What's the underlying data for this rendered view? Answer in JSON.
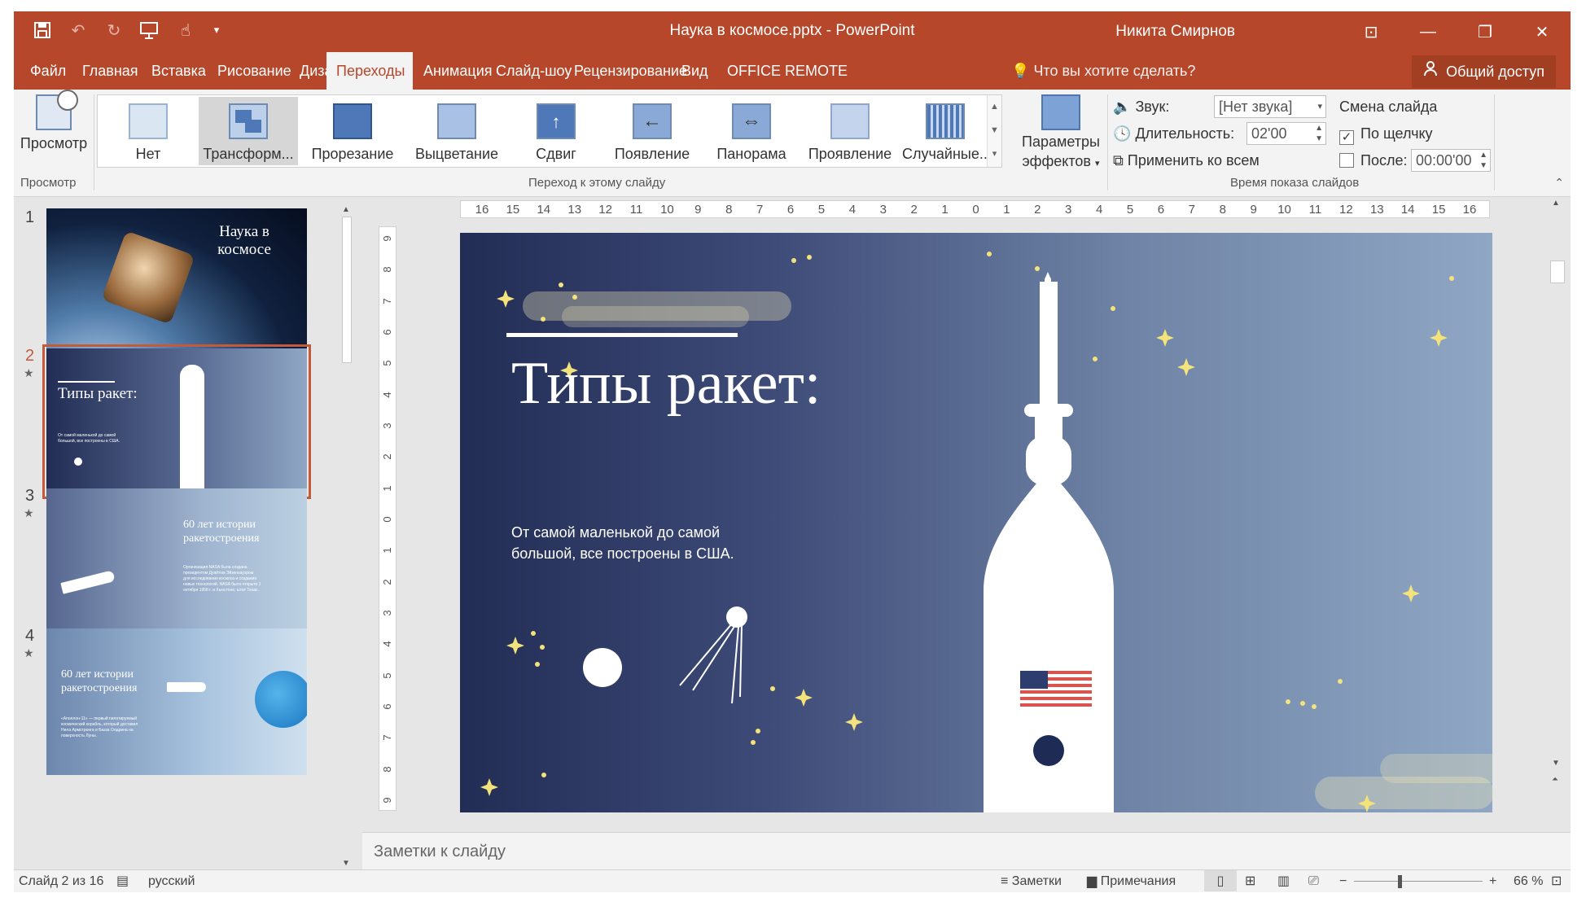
{
  "window": {
    "title": "Наука в космосе.pptx - PowerPoint",
    "user": "Никита Смирнов"
  },
  "tabs": [
    {
      "label": "Файл",
      "active": false
    },
    {
      "label": "Главная",
      "active": false
    },
    {
      "label": "Вставка",
      "active": false
    },
    {
      "label": "Рисование",
      "active": false
    },
    {
      "label": "Дизайн",
      "active": false
    },
    {
      "label": "Переходы",
      "active": true
    },
    {
      "label": "Анимация",
      "active": false
    },
    {
      "label": "Слайд-шоу",
      "active": false
    },
    {
      "label": "Рецензирование",
      "active": false
    },
    {
      "label": "Вид",
      "active": false
    },
    {
      "label": "OFFICE REMOTE",
      "active": false
    }
  ],
  "tell_me": "Что вы хотите сделать?",
  "share": "Общий доступ",
  "ribbon": {
    "preview_label": "Просмотр",
    "preview_group": "Просмотр",
    "transitions": [
      "Нет",
      "Трансформ...",
      "Прорезание",
      "Выцветание",
      "Сдвиг",
      "Появление",
      "Панорама",
      "Проявление",
      "Случайные..."
    ],
    "transitions_group": "Переход к этому слайду",
    "effects_line1": "Параметры",
    "effects_line2": "эффектов",
    "timing": {
      "sound_label": "Звук:",
      "sound_value": "[Нет звука]",
      "duration_label": "Длительность:",
      "duration_value": "02'00",
      "apply_all": "Применить ко всем",
      "advance_label": "Смена слайда",
      "on_click": "По щелчку",
      "after_label": "После:",
      "after_value": "00:00'00",
      "group": "Время показа слайдов"
    }
  },
  "thumbnails": {
    "s1_title": "Наука в космосе",
    "s2_title": "Типы ракет:",
    "s2_sub": "От самой маленькой до самой большой, все построены в США.",
    "s3_title": "60 лет истории ракетостроения",
    "s3_body": "Организация NASA была создана президентом Дуайтом Эйзенхауэром для исследования космоса и создания новых технологий. NASA было открыто 1 октября 1958 г. в Хьюстоне, штат Техас.",
    "s4_title": "60 лет истории ракетостроения",
    "s4_body": "«Аполлон-11» — первый пилотируемый космический корабль, который доставил Нила Армстронга и Базза Олдрина на поверхность Луны."
  },
  "slide": {
    "title": "Типы ракет:",
    "subtitle": "От самой маленькой до самой большой, все построены в США."
  },
  "notes_placeholder": "Заметки к слайду",
  "status": {
    "slide_info": "Слайд 2 из 16",
    "language": "русский",
    "notes_btn": "Заметки",
    "comments_btn": "Примечания",
    "zoom": "66 %"
  },
  "ruler": {
    "h": [
      "16",
      "15",
      "14",
      "13",
      "12",
      "11",
      "10",
      "9",
      "8",
      "7",
      "6",
      "5",
      "4",
      "3",
      "2",
      "1",
      "0",
      "1",
      "2",
      "3",
      "4",
      "5",
      "6",
      "7",
      "8",
      "9",
      "10",
      "11",
      "12",
      "13",
      "14",
      "15",
      "16"
    ],
    "v": [
      "9",
      "8",
      "7",
      "6",
      "5",
      "4",
      "3",
      "2",
      "1",
      "0",
      "1",
      "2",
      "3",
      "4",
      "5",
      "6",
      "7",
      "8",
      "9"
    ]
  },
  "colors": {
    "accent": "#b7472a",
    "star": "#f4e27a"
  }
}
